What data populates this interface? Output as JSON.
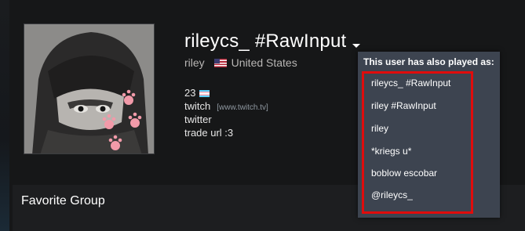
{
  "profile": {
    "persona_name": "rileycs_ #RawInput",
    "real_name": "riley",
    "country": "United States",
    "summary": {
      "age": "23",
      "twitch_label": "twitch",
      "twitch_link": "[www.twitch.tv]",
      "twitter_label": "twitter",
      "trade_url": "trade url :3"
    }
  },
  "aliases": {
    "header": "This user has also played as:",
    "items": [
      "rileycs_ #RawInput",
      "riley #RawInput",
      "riley",
      "*kriegs u*",
      "boblow escobar",
      "@rileycs_"
    ]
  },
  "group_section": {
    "title": "Favorite Group"
  },
  "colors": {
    "page_background": "#131416",
    "popup_background": "#3d4450",
    "highlight_border": "#e00c0c",
    "link_gray": "#8f98a0"
  },
  "icons": {
    "country_flag": "us-flag-icon",
    "summary_flag": "trans-flag-icon",
    "dropdown": "caret-down-icon"
  }
}
